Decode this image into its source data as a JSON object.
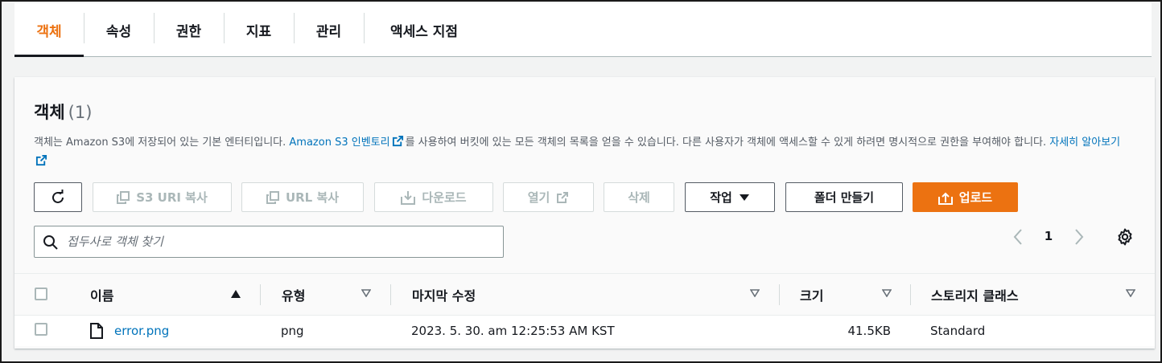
{
  "tabs": [
    {
      "label": "객체",
      "active": true
    },
    {
      "label": "속성",
      "active": false
    },
    {
      "label": "권한",
      "active": false
    },
    {
      "label": "지표",
      "active": false
    },
    {
      "label": "관리",
      "active": false
    },
    {
      "label": "액세스 지점",
      "active": false
    }
  ],
  "panel": {
    "title": "객체",
    "count": "(1)",
    "description": {
      "part1": "객체는 Amazon S3에 저장되어 있는 기본 엔터티입니다. ",
      "link1": "Amazon S3 인벤토리",
      "part2": "를 사용하여 버킷에 있는 모든 객체의 목록을 얻을 수 있습니다. 다른 사용자가 객체에 액세스할 수 있게 하려면 명시적으로 권한을 부여해야 합니다. ",
      "link2": "자세히 알아보기"
    }
  },
  "toolbar": {
    "refresh_icon": "refresh-icon",
    "copy_s3_uri": "S3 URI 복사",
    "copy_url": "URL 복사",
    "download": "다운로드",
    "open": "열기",
    "delete": "삭제",
    "actions": "작업",
    "create_folder": "폴더 만들기",
    "upload": "업로드"
  },
  "search": {
    "placeholder": "접두사로 객체 찾기",
    "value": ""
  },
  "pagination": {
    "current_page": "1"
  },
  "table": {
    "columns": [
      "이름",
      "유형",
      "마지막 수정",
      "크기",
      "스토리지 클래스"
    ],
    "rows": [
      {
        "name": "error.png",
        "type": "png",
        "last_modified": "2023. 5. 30. am 12:25:53 AM KST",
        "size": "41.5KB",
        "storage_class": "Standard"
      }
    ]
  },
  "colors": {
    "accent": "#ec7211",
    "link": "#0073bb",
    "text": "#16191f",
    "muted": "#545b64"
  }
}
